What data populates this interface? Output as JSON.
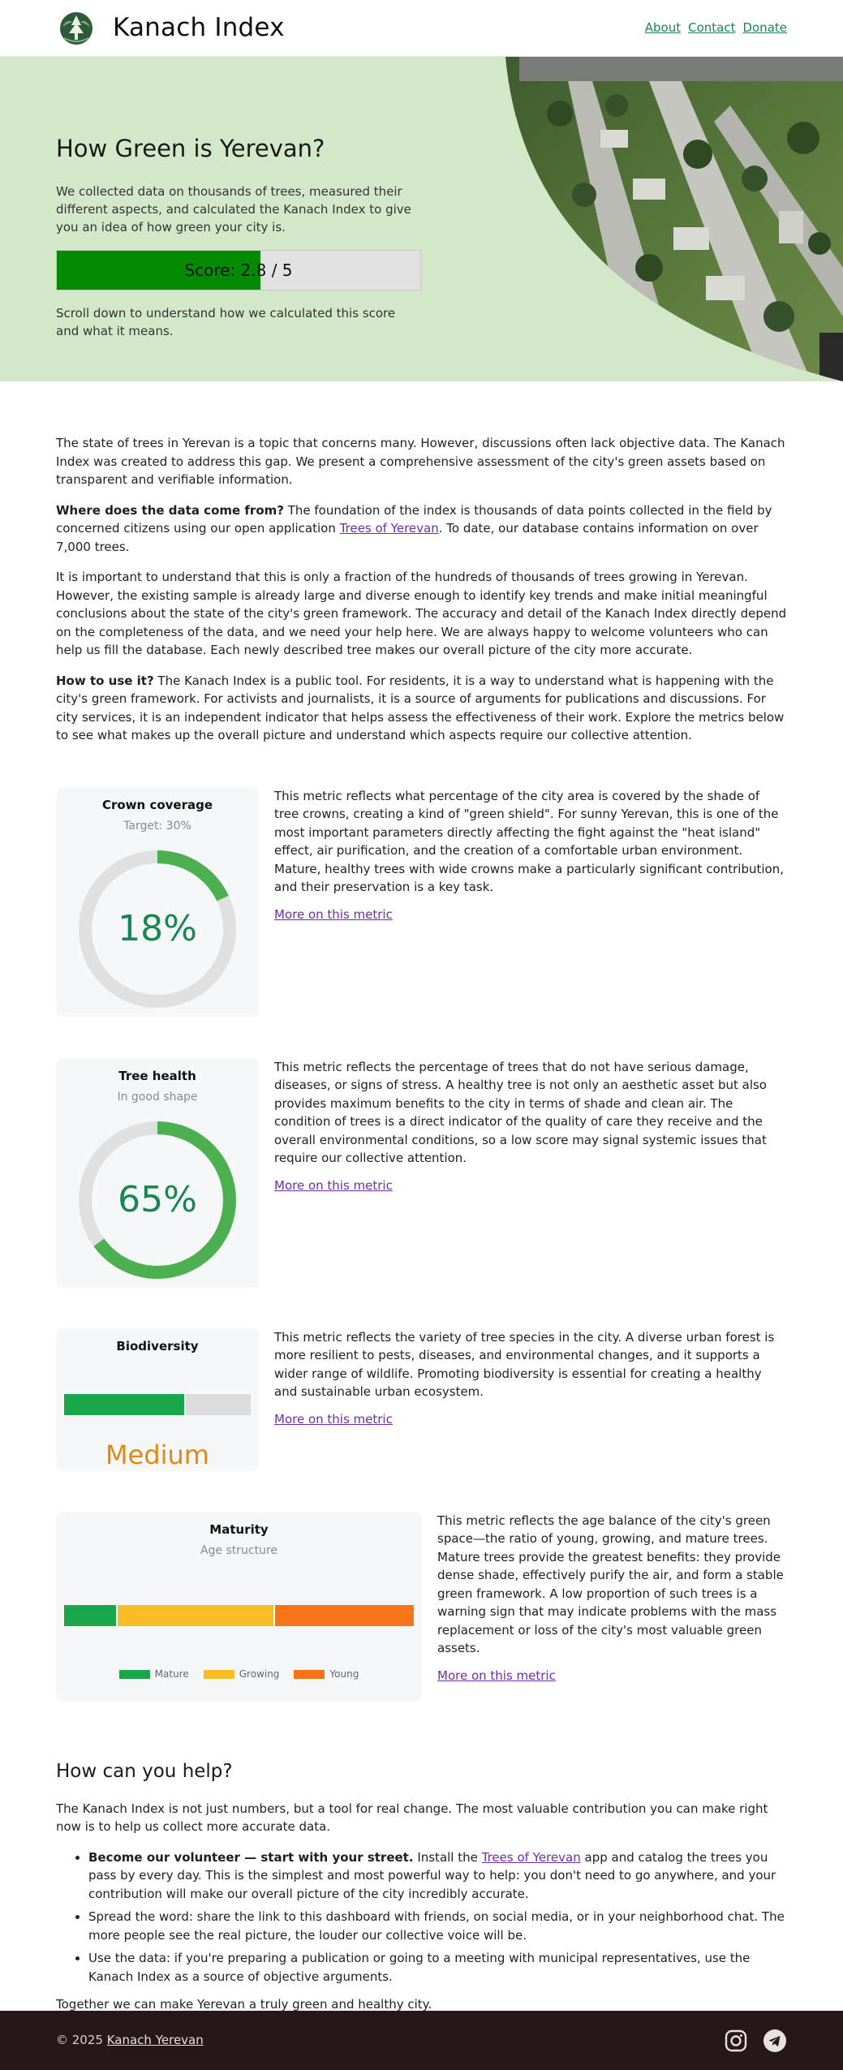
{
  "header": {
    "brand": "Kanach Index",
    "nav": {
      "about": "About",
      "contact": "Contact",
      "donate": "Donate"
    }
  },
  "hero": {
    "title": "How Green is Yerevan?",
    "description": "We collected data on thousands of trees, measured their different aspects, and calculated the Kanach Index to give you an idea of how green your city is.",
    "score_label": "Score: 2.8 / 5",
    "score_value": 2.8,
    "score_max": 5,
    "note": "Scroll down to understand how we calculated this score and what it means."
  },
  "intro": {
    "p1": "The state of trees in Yerevan is a topic that concerns many. However, discussions often lack objective data. The Kanach Index was created to address this gap. We present a comprehensive assessment of the city's green assets based on transparent and verifiable information.",
    "p2_bold": "Where does the data come from?",
    "p2_before_link": " The foundation of the index is thousands of data points collected in the field by concerned citizens using our open application ",
    "p2_link": "Trees of Yerevan",
    "p2_after_link": ". To date, our database contains information on over 7,000 trees.",
    "p3": "It is important to understand that this is only a fraction of the hundreds of thousands of trees growing in Yerevan. However, the existing sample is already large and diverse enough to identify key trends and make initial meaningful conclusions about the state of the city's green framework. The accuracy and detail of the Kanach Index directly depend on the completeness of the data, and we need your help here. We are always happy to welcome volunteers who can help us fill the database. Each newly described tree makes our overall picture of the city more accurate.",
    "p4_bold": "How to use it?",
    "p4": " The Kanach Index is a public tool. For residents, it is a way to understand what is happening with the city's green framework. For activists and journalists, it is a source of arguments for publications and discussions. For city services, it is an independent indicator that helps assess the effectiveness of their work. Explore the metrics below to see what makes up the overall picture and understand which aspects require our collective attention."
  },
  "metrics": {
    "more_label": "More on this metric",
    "crown": {
      "title": "Crown coverage",
      "subtitle": "Target: 30%",
      "value_label": "18%",
      "value": 18,
      "text": "This metric reflects what percentage of the city area is covered by the shade of tree crowns, creating a kind of \"green shield\". For sunny Yerevan, this is one of the most important parameters directly affecting the fight against the \"heat island\" effect, air purification, and the creation of a comfortable urban environment. Mature, healthy trees with wide crowns make a particularly significant contribution, and their preservation is a key task."
    },
    "health": {
      "title": "Tree health",
      "subtitle": "In good shape",
      "value_label": "65%",
      "value": 65,
      "text": "This metric reflects the percentage of trees that do not have serious damage, diseases, or signs of stress. A healthy tree is not only an aesthetic asset but also provides maximum benefits to the city in terms of shade and clean air. The condition of trees is a direct indicator of the quality of care they receive and the overall environmental conditions, so a low score may signal systemic issues that require our collective attention."
    },
    "biodiversity": {
      "title": "Biodiversity",
      "value_label": "Medium",
      "level": 0.65,
      "text": "This metric reflects the variety of tree species in the city. A diverse urban forest is more resilient to pests, diseases, and environmental changes, and it supports a wider range of wildlife. Promoting biodiversity is essential for creating a healthy and sustainable urban ecosystem."
    },
    "maturity": {
      "title": "Maturity",
      "subtitle": "Age structure",
      "segments": [
        {
          "name": "Mature",
          "share": 15,
          "color": "#1aa64b"
        },
        {
          "name": "Growing",
          "share": 45,
          "color": "#fbbd26"
        },
        {
          "name": "Young",
          "share": 40,
          "color": "#f77418"
        }
      ],
      "text": "This metric reflects the age balance of the city's green space—the ratio of young, growing, and mature trees. Mature trees provide the greatest benefits: they provide dense shade, effectively purify the air, and form a stable green framework. A low proportion of such trees is a warning sign that may indicate problems with the mass replacement or loss of the city's most valuable green assets."
    }
  },
  "help": {
    "title": "How can you help?",
    "intro": "The Kanach Index is not just numbers, but a tool for real change. The most valuable contribution you can make right now is to help us collect more accurate data.",
    "item1_bold": "Become our volunteer — start with your street.",
    "item1_before_link": " Install the ",
    "item1_link": "Trees of Yerevan",
    "item1_after_link": " app and catalog the trees you pass by every day. This is the simplest and most powerful way to help: you don't need to go anywhere, and your contribution will make our overall picture of the city incredibly accurate.",
    "item2": "Spread the word: share the link to this dashboard with friends, on social media, or in your neighborhood chat. The more people see the real picture, the louder our collective voice will be.",
    "item3": "Use the data: if you're preparing a publication or going to a meeting with municipal representatives, use the Kanach Index as a source of objective arguments.",
    "closing": "Together we can make Yerevan a truly green and healthy city."
  },
  "footer": {
    "copyright": "© 2025 ",
    "link": "Kanach Yerevan",
    "icons": [
      "instagram-icon",
      "telegram-icon"
    ]
  },
  "colors": {
    "green": "#198754",
    "ring_track": "#e0e0e0",
    "ring_fill": "#4caf50",
    "score_fill": "#038a03",
    "bio_fill": "#1aa64b",
    "bio_value": "#df8a16",
    "hero_bg": "#d3e8c9",
    "footer_bg": "#261719"
  }
}
